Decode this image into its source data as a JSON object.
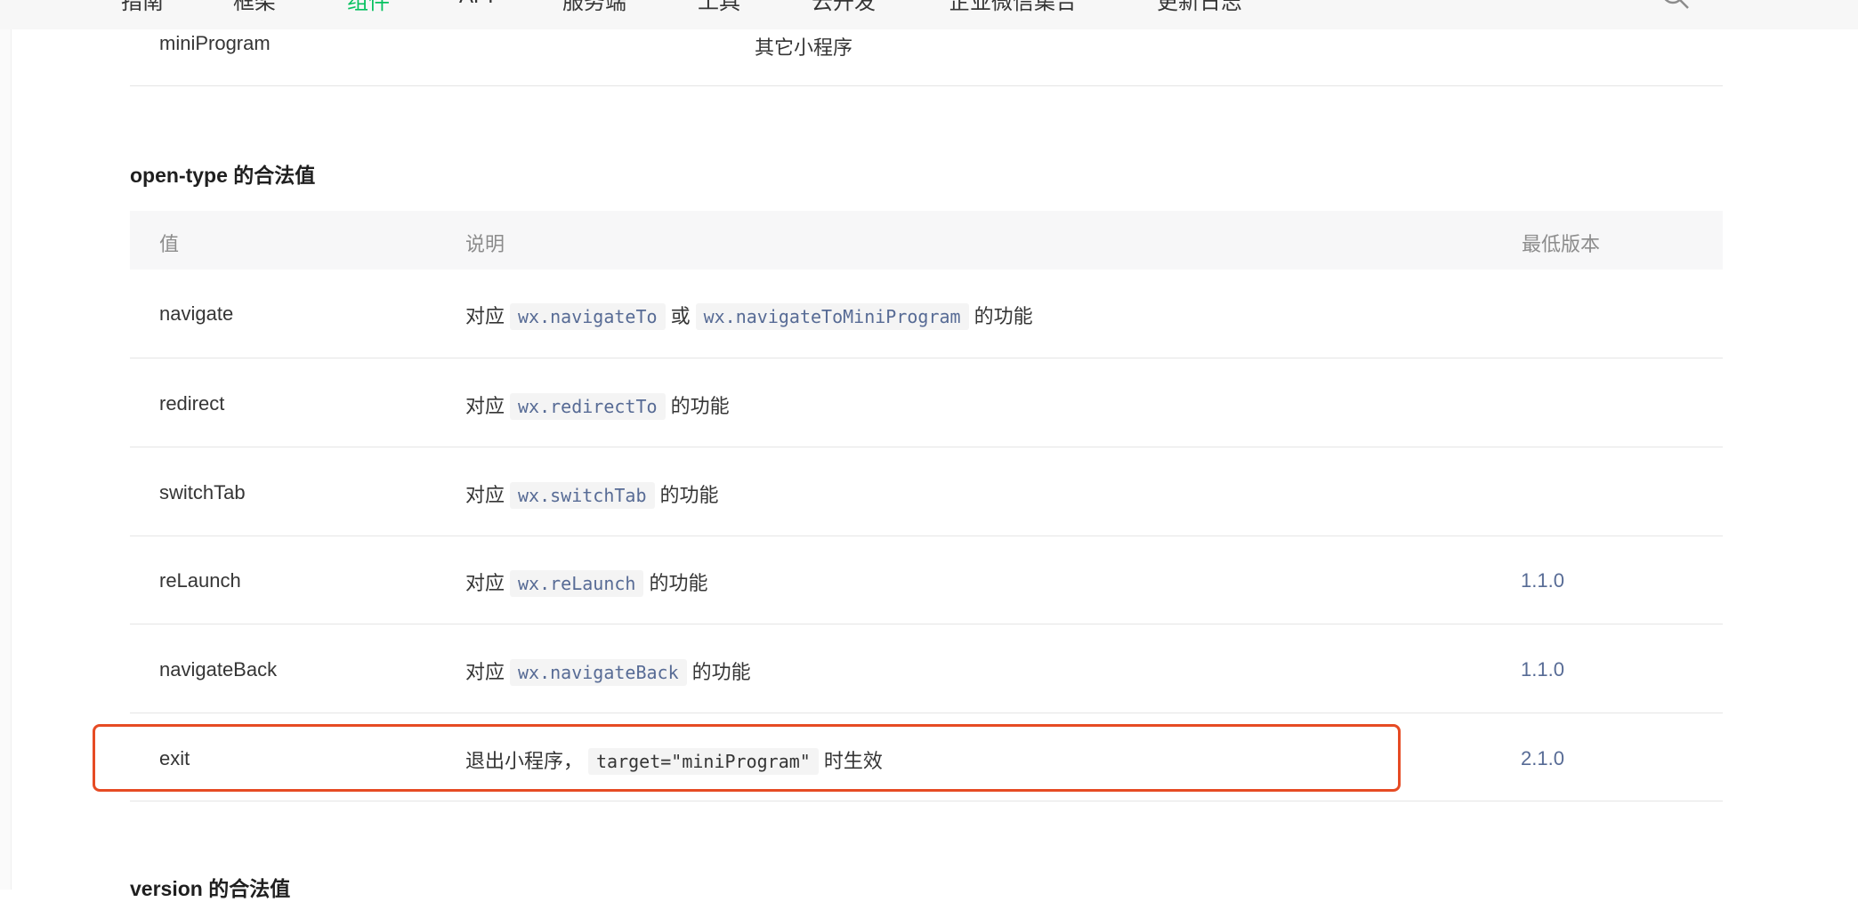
{
  "nav": {
    "items": [
      "指南",
      "框架",
      "组件",
      "API",
      "服务端",
      "工具",
      "云开发",
      "企业微信集合",
      "更新日志"
    ],
    "active_index": 2
  },
  "prev_table_row": {
    "value": "miniProgram",
    "desc": "其它小程序"
  },
  "open_type_section": {
    "title": "open-type 的合法值",
    "headers": {
      "value": "值",
      "desc": "说明",
      "version": "最低版本"
    },
    "rows": [
      {
        "value": "navigate",
        "desc": [
          "对应",
          "wx.navigateTo",
          "或",
          "wx.navigateToMiniProgram",
          "的功能"
        ],
        "version": ""
      },
      {
        "value": "redirect",
        "desc": [
          "对应",
          "wx.redirectTo",
          "的功能"
        ],
        "version": ""
      },
      {
        "value": "switchTab",
        "desc": [
          "对应",
          "wx.switchTab",
          "的功能"
        ],
        "version": ""
      },
      {
        "value": "reLaunch",
        "desc": [
          "对应",
          "wx.reLaunch",
          "的功能"
        ],
        "version": "1.1.0"
      },
      {
        "value": "navigateBack",
        "desc": [
          "对应",
          "wx.navigateBack",
          "的功能"
        ],
        "version": "1.1.0"
      },
      {
        "value": "exit",
        "desc": [
          "退出小程序，",
          "target=\"miniProgram\"",
          "时生效"
        ],
        "version": "2.1.0"
      }
    ]
  },
  "next_section": {
    "title": "version 的合法值"
  },
  "colors": {
    "link": "#576b95",
    "active_nav": "#07c160",
    "highlight_border": "#e64b24"
  }
}
